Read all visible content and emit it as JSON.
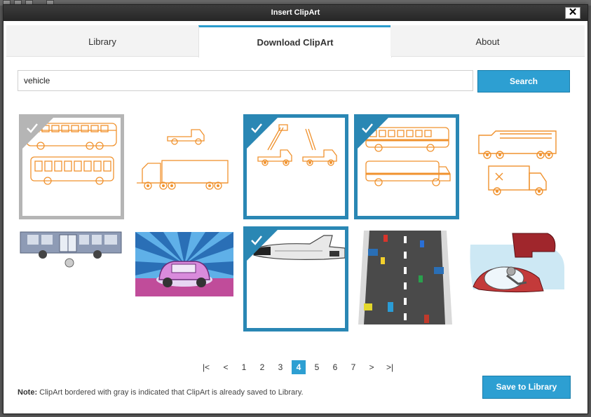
{
  "dialog": {
    "title": "Insert ClipArt",
    "close_glyph": "✕"
  },
  "tabs": [
    {
      "label": "Library",
      "active": false
    },
    {
      "label": "Download ClipArt",
      "active": true
    },
    {
      "label": "About",
      "active": false
    }
  ],
  "search": {
    "value": "vehicle",
    "placeholder": "",
    "button_label": "Search"
  },
  "results": [
    {
      "subject": "buses-outline",
      "status": "saved"
    },
    {
      "subject": "trucks-outline",
      "status": "none"
    },
    {
      "subject": "crane-trucks-outline",
      "status": "selected"
    },
    {
      "subject": "school-buses-outline",
      "status": "selected"
    },
    {
      "subject": "fire-truck-ambulance-outline",
      "status": "none"
    },
    {
      "subject": "city-bus",
      "status": "none"
    },
    {
      "subject": "retro-car-rays",
      "status": "none"
    },
    {
      "subject": "space-shuttle",
      "status": "selected"
    },
    {
      "subject": "highway-traffic",
      "status": "none"
    },
    {
      "subject": "futuristic-vehicle",
      "status": "none"
    }
  ],
  "pagination": {
    "first": "|<",
    "prev": "<",
    "pages": [
      "1",
      "2",
      "3",
      "4",
      "5",
      "6",
      "7"
    ],
    "current": "4",
    "next": ">",
    "last": ">|"
  },
  "footer": {
    "note_label": "Note:",
    "note_text": " ClipArt bordered with gray is indicated that ClipArt is already saved to Library.",
    "save_button_label": "Save to Library"
  },
  "colors": {
    "accent": "#2d9fd2",
    "selected_border": "#2a87b4",
    "saved_border": "#b5b5b5",
    "outline_art": "#f0922e"
  }
}
